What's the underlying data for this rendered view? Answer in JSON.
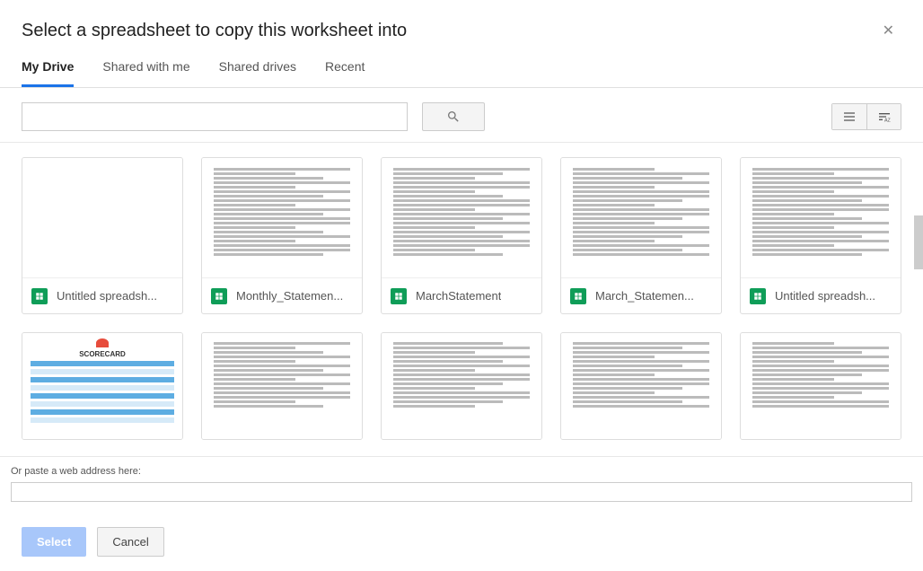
{
  "dialog": {
    "title": "Select a spreadsheet to copy this worksheet into"
  },
  "tabs": [
    {
      "label": "My Drive",
      "active": true
    },
    {
      "label": "Shared with me",
      "active": false
    },
    {
      "label": "Shared drives",
      "active": false
    },
    {
      "label": "Recent",
      "active": false
    }
  ],
  "search": {
    "value": "",
    "placeholder": ""
  },
  "files_row1": [
    {
      "label": "Untitled spreadsh...",
      "thumb_type": "blank"
    },
    {
      "label": "Monthly_Statemen...",
      "thumb_type": "dense"
    },
    {
      "label": "MarchStatement",
      "thumb_type": "dense"
    },
    {
      "label": "March_Statemen...",
      "thumb_type": "dense"
    },
    {
      "label": "Untitled spreadsh...",
      "thumb_type": "dense"
    }
  ],
  "files_row2": [
    {
      "thumb_type": "scorecard",
      "scorecard_title": "SCORECARD"
    },
    {
      "thumb_type": "dense"
    },
    {
      "thumb_type": "dense"
    },
    {
      "thumb_type": "dense"
    },
    {
      "thumb_type": "dense"
    }
  ],
  "paste": {
    "label": "Or paste a web address here:",
    "value": ""
  },
  "buttons": {
    "select": "Select",
    "cancel": "Cancel"
  }
}
